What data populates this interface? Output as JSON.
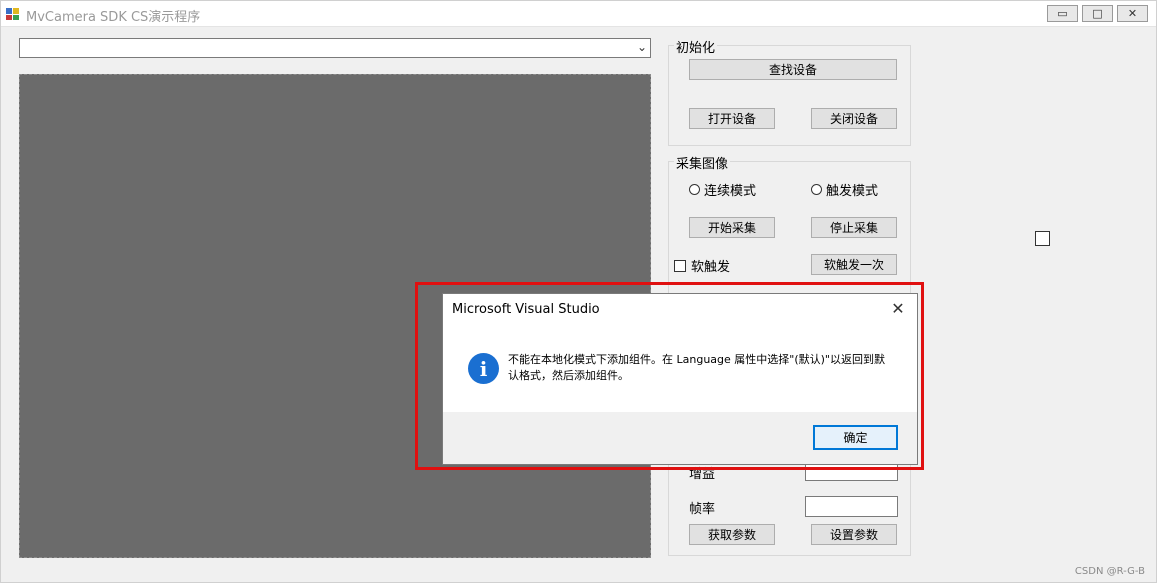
{
  "window": {
    "title": "MvCamera SDK CS演示程序",
    "minimize_glyph": "▭",
    "maximize_glyph": "□",
    "close_glyph": "✕"
  },
  "device_combo": {
    "value": "",
    "arrow_glyph": "⌄"
  },
  "init_group": {
    "title": "初始化",
    "find_button": "查找设备",
    "open_button": "打开设备",
    "close_button": "关闭设备"
  },
  "capture_group": {
    "title": "采集图像",
    "continuous_mode": "连续模式",
    "trigger_mode": "触发模式",
    "start_button": "开始采集",
    "stop_button": "停止采集",
    "soft_trigger_checkbox": "软触发",
    "soft_trigger_once_button": "软触发一次"
  },
  "params_group": {
    "gain_label": "增益",
    "framerate_label": "帧率",
    "gain_value": "",
    "framerate_value": "",
    "get_button": "获取参数",
    "set_button": "设置参数"
  },
  "dialog": {
    "title": "Microsoft Visual Studio",
    "close_glyph": "✕",
    "icon_glyph": "i",
    "message": "不能在本地化模式下添加组件。在 Language 属性中选择\"(默认)\"以返回到默认格式，然后添加组件。",
    "ok_button": "确定"
  },
  "watermark": "CSDN @R-G-B",
  "colors": {
    "highlight": "#e01010",
    "accent": "#0078d7",
    "info_icon": "#1a6fd1",
    "display_bg": "#6b6b6b"
  }
}
